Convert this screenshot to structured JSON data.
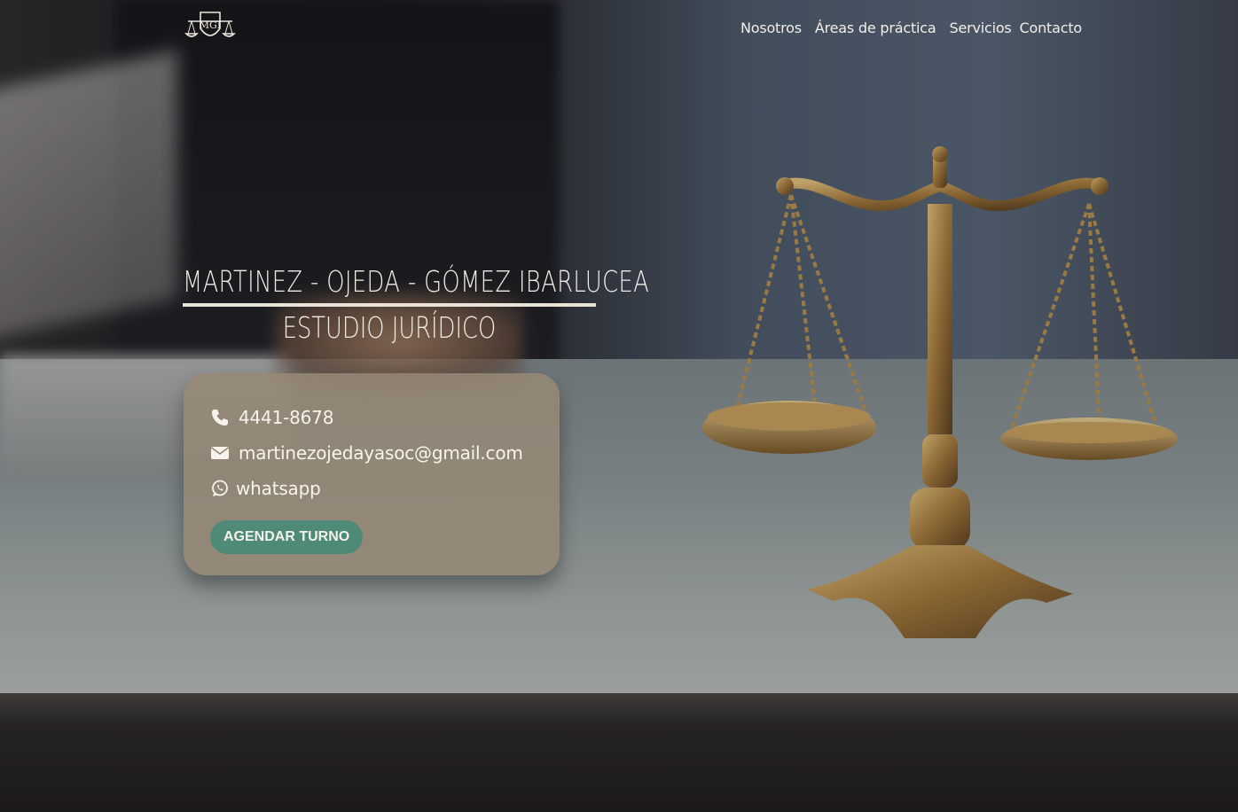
{
  "header": {
    "logo_text": "MGI",
    "nav": [
      "Nosotros",
      "Áreas de práctica",
      "Servicios",
      "Contacto"
    ]
  },
  "hero": {
    "title": "Martinez - Ojeda - Gómez Ibarlucea",
    "subtitle": "Estudio Jurídico"
  },
  "contact": {
    "phone": "4441-8678",
    "email": "martinezojedayasoc@gmail.com",
    "whatsapp": "whatsapp",
    "cta_label": "AGENDAR TURNO"
  },
  "colors": {
    "card_bg": "#968876",
    "cta_bg": "#4f8a78",
    "text_light": "#f3efe8"
  },
  "icons": [
    "phone-icon",
    "envelope-icon",
    "whatsapp-icon",
    "scales-logo-icon"
  ]
}
